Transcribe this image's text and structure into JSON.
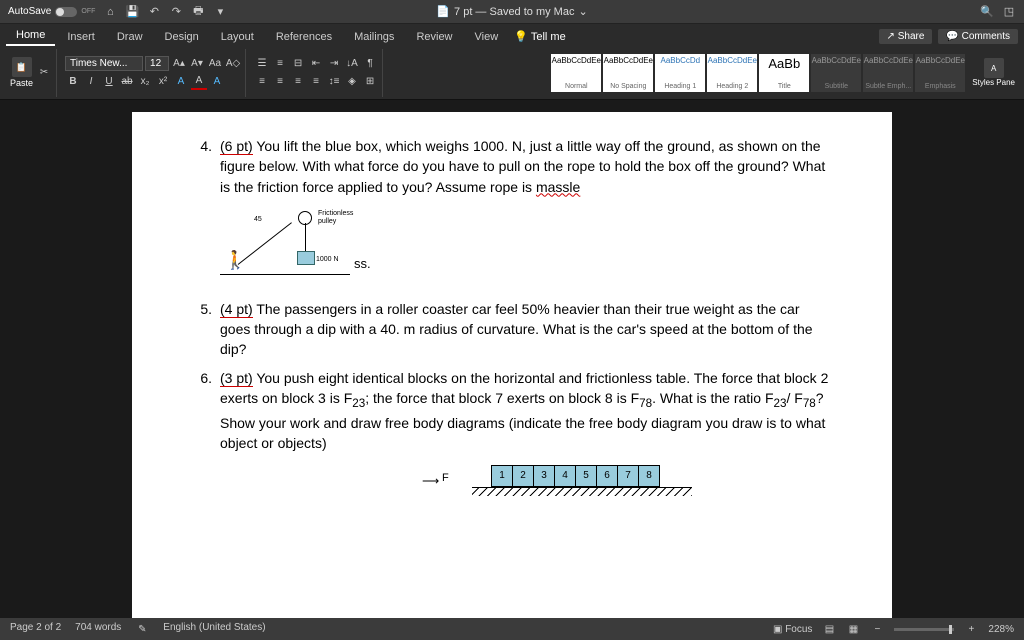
{
  "titlebar": {
    "autosave": "AutoSave",
    "autosave_state": "OFF",
    "doc": "7 pt — Saved to my Mac",
    "chevron": "⌄"
  },
  "tabs": [
    "Home",
    "Insert",
    "Draw",
    "Design",
    "Layout",
    "References",
    "Mailings",
    "Review",
    "View"
  ],
  "tellme": "Tell me",
  "share": "Share",
  "comments": "Comments",
  "ribbon": {
    "paste": "Paste",
    "font_name": "Times New...",
    "font_size": "12",
    "stylepane": "Styles Pane"
  },
  "styles": [
    {
      "sample": "AaBbCcDdEe",
      "name": "Normal"
    },
    {
      "sample": "AaBbCcDdEe",
      "name": "No Spacing"
    },
    {
      "sample": "AaBbCcDd",
      "name": "Heading 1"
    },
    {
      "sample": "AaBbCcDdEe",
      "name": "Heading 2"
    },
    {
      "sample": "AaBb",
      "name": "Title"
    },
    {
      "sample": "AaBbCcDdEe",
      "name": "Subtitle"
    },
    {
      "sample": "AaBbCcDdEe",
      "name": "Subtle Emph..."
    },
    {
      "sample": "AaBbCcDdEe",
      "name": "Emphasis"
    }
  ],
  "doc": {
    "q4": {
      "num": "4.",
      "pts": "(6 pt)",
      "text_a": " You lift the blue box, which weighs 1000. N, just a little way off the ground, as shown on the figure below.  With what force do you have to pull on the rope to hold the box off the ground?  What is the friction force applied to you? Assume rope is ",
      "massle": "massle"
    },
    "fig": {
      "frictionless": "Frictionless",
      "pulley": "pulley",
      "angle": "45",
      "weight": "1000 N",
      "ss": "ss."
    },
    "q5": {
      "num": "5.",
      "pts": "(4 pt)",
      "text": " The passengers in a roller coaster car feel 50% heavier than their true weight as the car goes through a dip with a 40. m radius of curvature. What is the car's speed at the bottom of the dip?"
    },
    "q6": {
      "num": "6.",
      "pts": "(3 pt)",
      "text_a": " You push eight identical blocks on the horizontal and frictionless table. The force that block 2 exerts on block 3 is F",
      "s23": "23",
      "text_b": "; the force that block 7 exerts on block 8 is F",
      "s78": "78",
      "text_c": ". What is the ratio F",
      "text_d": "/ F",
      "text_e": "? Show your work and draw free body diagrams (indicate the free body diagram you draw is to what object or objects)"
    },
    "boxes": {
      "F": "F",
      "n": [
        "1",
        "2",
        "3",
        "4",
        "5",
        "6",
        "7",
        "8"
      ]
    }
  },
  "status": {
    "page": "Page 2 of 2",
    "words": "704 words",
    "lang": "English (United States)",
    "focus": "Focus",
    "zoom": "228%"
  }
}
